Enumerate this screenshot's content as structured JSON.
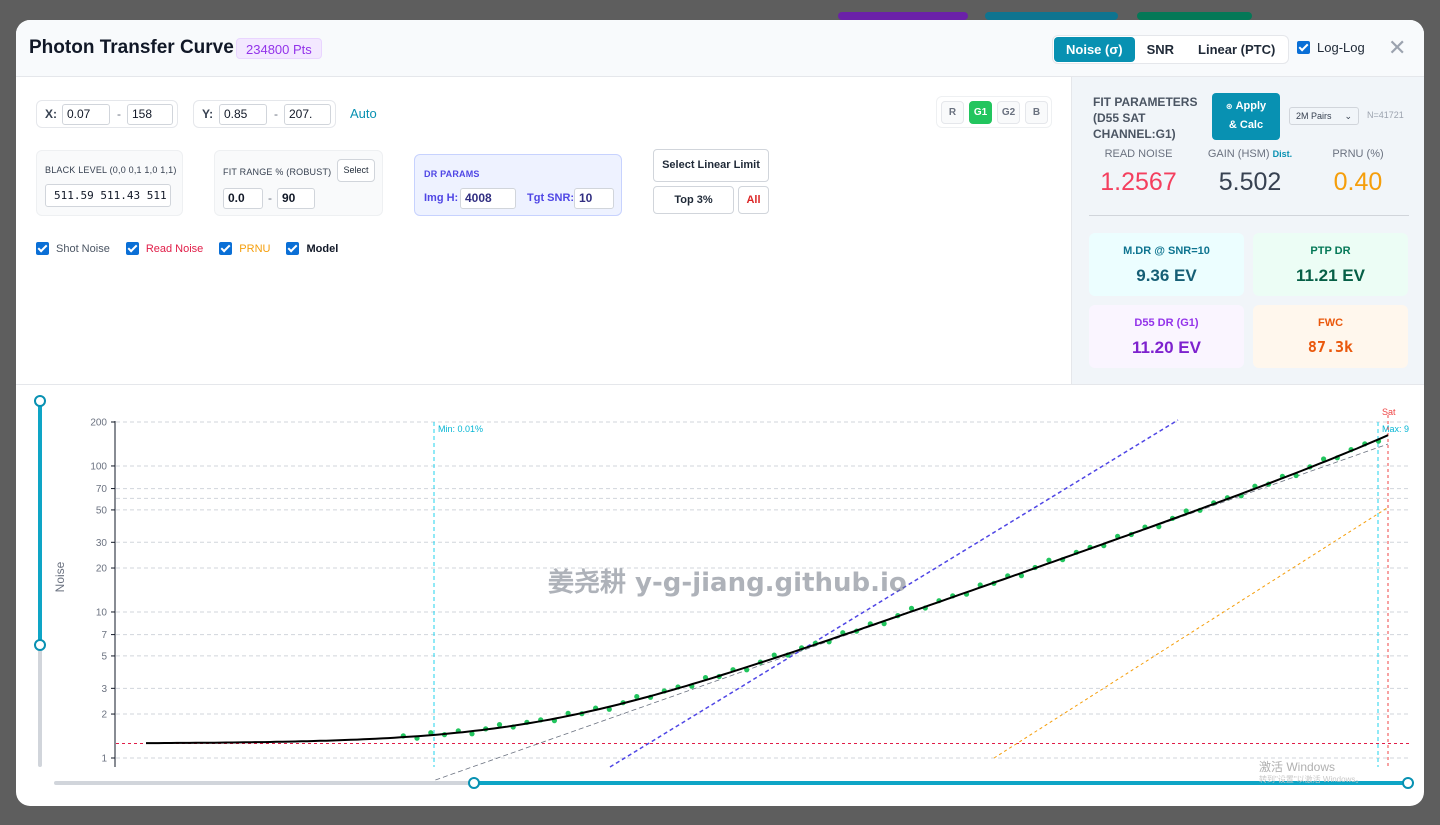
{
  "header": {
    "title": "Photon Transfer Curve",
    "points_badge": "234800 Pts",
    "modes": [
      "Noise (σ)",
      "SNR",
      "Linear (PTC)"
    ],
    "active_mode": "Noise (σ)",
    "loglog_label": "Log-Log",
    "loglog_checked": true,
    "close_icon": "close-icon"
  },
  "controls": {
    "x_label": "X:",
    "x_min": "0.07",
    "x_max": "158",
    "y_label": "Y:",
    "y_min": "0.85",
    "y_max": "207.",
    "auto_label": "Auto",
    "black_level_label": "BLACK LEVEL (0,0 0,1 1,0 1,1)",
    "black_level_value": "511.59 511.43 511",
    "fit_range_label": "FIT RANGE % (ROBUST)",
    "fit_select_label": "Select",
    "fit_min": "0.0",
    "fit_max": "90",
    "dr_params_label": "DR PARAMS",
    "img_h_label": "Img H:",
    "img_h_value": "4008",
    "tgt_snr_label": "Tgt SNR:",
    "tgt_snr_value": "10",
    "select_linear_label": "Select Linear Limit",
    "top3_label": "Top 3%",
    "all_label": "All",
    "channels": [
      "R",
      "G1",
      "G2",
      "B"
    ],
    "active_channel": "G1"
  },
  "toggles": [
    {
      "label": "Shot Noise",
      "color": "#4b5563",
      "checked": true
    },
    {
      "label": "Read Noise",
      "color": "#e11d48",
      "checked": true
    },
    {
      "label": "PRNU",
      "color": "#f59e0b",
      "checked": true
    },
    {
      "label": "Model",
      "color": "#111827",
      "checked": true
    }
  ],
  "fit": {
    "title": "FIT PARAMETERS (D55 SAT CHANNEL:G1)",
    "apply_label_1": "Apply",
    "apply_label_2": "& Calc",
    "pairs_label": "2M Pairs",
    "n_label": "N=41721",
    "read_noise_label": "READ NOISE",
    "read_noise_value": "1.2567",
    "gain_label": "GAIN (HSM)",
    "dist_label": "Dist.",
    "gain_value": "5.502",
    "prnu_label": "PRNU (%)",
    "prnu_value": "0.40"
  },
  "cards": [
    {
      "label": "M.DR @ SNR=10",
      "value": "9.36 EV",
      "bg": "#ecfeff",
      "fg": "#0e7490"
    },
    {
      "label": "PTP DR",
      "value": "11.21 EV",
      "bg": "#ecfdf5",
      "fg": "#047857"
    },
    {
      "label": "D55 DR (G1)",
      "value": "11.20 EV",
      "bg": "#faf5ff",
      "fg": "#7e22ce"
    },
    {
      "label": "FWC",
      "value": "87.3k",
      "bg": "#fff7ed",
      "fg": "#ea580c"
    }
  ],
  "chart_data": {
    "type": "scatter",
    "title": "",
    "xlabel": "",
    "ylabel": "Noise",
    "y_scale": "log",
    "x_scale": "log",
    "ylim": [
      0.85,
      207
    ],
    "y_ticks": [
      1,
      2,
      3,
      5,
      7,
      10,
      20,
      30,
      50,
      70,
      100,
      200
    ],
    "annotations": [
      "Min: 0.01%",
      "Max: 9",
      "Sat"
    ],
    "series": [
      {
        "name": "Shot Noise",
        "color": "#6b7280",
        "style": "dashed"
      },
      {
        "name": "Read Noise",
        "color": "#e11d48",
        "style": "dashed"
      },
      {
        "name": "PRNU",
        "color": "#f59e0b",
        "style": "dotted"
      },
      {
        "name": "Model",
        "color": "#000000",
        "style": "solid"
      }
    ],
    "model": {
      "read_noise": 1.2567,
      "gain": 5.502,
      "prnu": 0.004
    }
  },
  "watermark": "姜尧耕 y-g-jiang.github.io",
  "os_overlay": {
    "line1": "激活 Windows",
    "line2": "转到\"设置\"以激活 Windows。"
  }
}
